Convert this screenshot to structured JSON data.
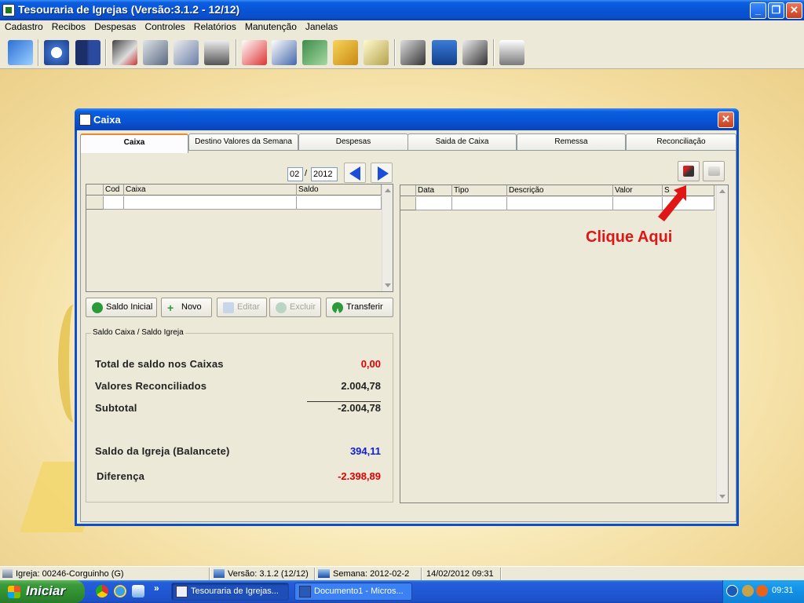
{
  "window": {
    "title": "Tesouraria de Igrejas   (Versão:3.1.2 - 12/12)",
    "minimize": "_",
    "maximize": "❐",
    "close": "✕"
  },
  "menu": [
    "Cadastro",
    "Recibos",
    "Despesas",
    "Controles",
    "Relatórios",
    "Manutenção",
    "Janelas"
  ],
  "dialog": {
    "title": "Caixa",
    "close": "✕",
    "tabs": [
      "Caixa",
      "Destino Valores da Semana",
      "Despesas",
      "Saida de Caixa",
      "Remessa",
      "Reconciliação"
    ],
    "period": {
      "month": "02",
      "separator": "/",
      "year": "2012"
    },
    "left_grid": {
      "columns": [
        "Cod",
        "Caixa",
        "Saldo"
      ]
    },
    "right_grid": {
      "columns": [
        "Data",
        "Tipo",
        "Descrição",
        "Valor",
        "S"
      ]
    },
    "buttons": {
      "saldo_inicial": "Saldo Inicial",
      "novo": "Novo",
      "editar": "Editar",
      "excluir": "Excluir",
      "transferir": "Transferir"
    },
    "summary": {
      "legend": "Saldo Caixa / Saldo Igreja",
      "total_label": "Total de saldo nos Caixas",
      "total_value": "0,00",
      "reconciliados_label": "Valores Reconciliados",
      "reconciliados_value": "2.004,78",
      "subtotal_label": "Subtotal",
      "subtotal_value": "-2.004,78",
      "saldo_igreja_label": "Saldo da Igreja (Balancete)",
      "saldo_igreja_value": "394,11",
      "diferenca_label": "Diferença",
      "diferenca_value": "-2.398,89"
    }
  },
  "annotation": {
    "text": "Clique Aqui",
    "color": "#e01515"
  },
  "statusbar": {
    "igreja": "Igreja: 00246-Corguinho (G)",
    "versao": "Versão: 3.1.2 (12/12)",
    "semana": "Semana: 2012-02-2",
    "datetime": "14/02/2012  09:31"
  },
  "taskbar": {
    "start": "Iniciar",
    "chevron": "»",
    "tasks": [
      "Tesouraria de Igrejas...",
      "Documento1 - Micros..."
    ],
    "clock": "09:31"
  }
}
